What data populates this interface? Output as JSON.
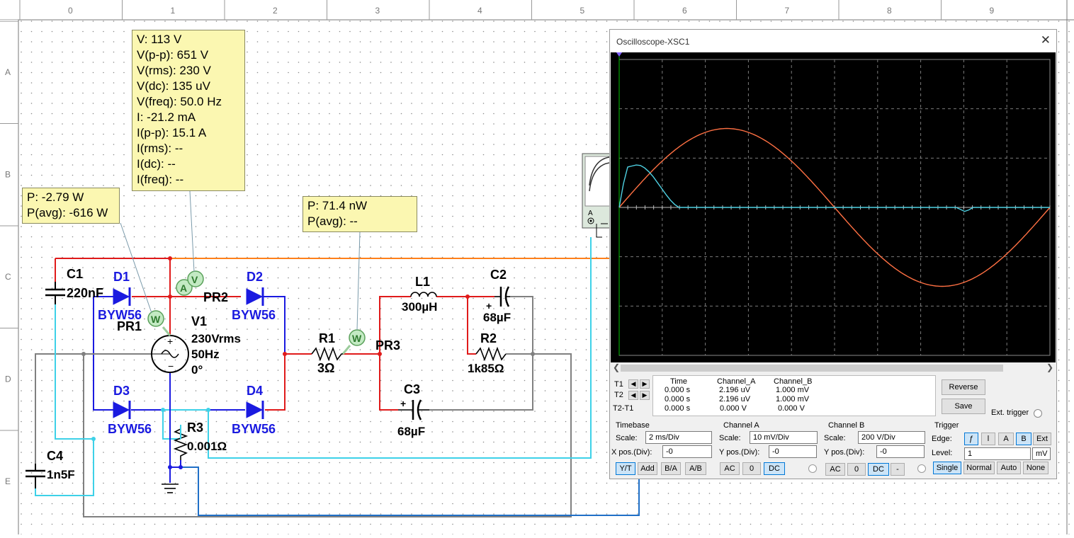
{
  "ruler": {
    "columns": [
      "0",
      "1",
      "2",
      "3",
      "4",
      "5",
      "6",
      "7",
      "8",
      "9"
    ],
    "rows": [
      "A",
      "B",
      "C",
      "D",
      "E"
    ]
  },
  "probes": {
    "v_probe": [
      "V: 113 V",
      "V(p-p): 651 V",
      "V(rms): 230 V",
      "V(dc): 135 uV",
      "V(freq): 50.0 Hz",
      "I: -21.2 mA",
      "I(p-p): 15.1 A",
      "I(rms): --",
      "I(dc): --",
      "I(freq): --"
    ],
    "pr1": [
      "P: -2.79 W",
      "P(avg): -616 W"
    ],
    "pr3": [
      "P: 71.4 nW",
      "P(avg): --"
    ]
  },
  "components": {
    "c1_name": "C1",
    "c1_value": "220nF",
    "d1_name": "D1",
    "d1_value": "BYW56",
    "d2_name": "D2",
    "d2_value": "BYW56",
    "d3_name": "D3",
    "d3_value": "BYW56",
    "d4_name": "D4",
    "d4_value": "BYW56",
    "v1_name": "V1",
    "v1_rms": "230Vrms",
    "v1_freq": "50Hz",
    "v1_phase": "0°",
    "pr1": "PR1",
    "pr2": "PR2",
    "pr3": "PR3",
    "r1_name": "R1",
    "r1_value": "3Ω",
    "r2_name": "R2",
    "r2_value": "1k85Ω",
    "r3_name": "R3",
    "r3_value": "0.001Ω",
    "l1_name": "L1",
    "l1_value": "300µH",
    "c2_name": "C2",
    "c2_value": "68µF",
    "c3_name": "C3",
    "c3_value": "68µF",
    "c4_name": "C4",
    "c4_value": "1n5F",
    "xsc_terminal": "A",
    "probe_w": "W",
    "probe_a": "A",
    "probe_v": "V"
  },
  "colors": {
    "wire_red": "#e01a1a",
    "wire_blue": "#1a1ae0",
    "wire_cyan": "#3dd1e8",
    "wire_orange": "#ff7f1a",
    "wire_gray": "#808080",
    "trace_a": "#4fd1e3",
    "trace_b": "#ff7043",
    "probe_bg": "#fbf7b1"
  },
  "oscilloscope": {
    "title": "Oscilloscope-XSC1",
    "close": "✕",
    "cursor_labels": {
      "t1": "T1",
      "t2": "T2",
      "t2t1": "T2-T1"
    },
    "table": {
      "headers": [
        "Time",
        "Channel_A",
        "Channel_B"
      ],
      "t1": [
        "0.000 s",
        "2.196 uV",
        "1.000 mV"
      ],
      "t2": [
        "0.000 s",
        "2.196 uV",
        "1.000 mV"
      ],
      "t2t1": [
        "0.000 s",
        "0.000 V",
        "0.000 V"
      ]
    },
    "reverse": "Reverse",
    "save": "Save",
    "ext_trigger": "Ext. trigger",
    "timebase": {
      "label": "Timebase",
      "scale_label": "Scale:",
      "scale": "2 ms/Div",
      "xpos_label": "X pos.(Div):",
      "xpos": "-0",
      "buttons": [
        "Y/T",
        "Add",
        "B/A",
        "A/B"
      ]
    },
    "channel_a": {
      "label": "Channel A",
      "scale_label": "Scale:",
      "scale": "10 mV/Div",
      "ypos_label": "Y pos.(Div):",
      "ypos": "-0",
      "buttons": [
        "AC",
        "0",
        "DC"
      ]
    },
    "channel_b": {
      "label": "Channel B",
      "scale_label": "Scale:",
      "scale": "200  V/Div",
      "ypos_label": "Y pos.(Div):",
      "ypos": "-0",
      "buttons": [
        "AC",
        "0",
        "DC",
        "-"
      ]
    },
    "trigger": {
      "label": "Trigger",
      "edge_label": "Edge:",
      "level_label": "Level:",
      "level": "1",
      "level_unit": "mV",
      "edge_buttons": [
        "ƒ",
        "Ɩ",
        "A",
        "B",
        "Ext"
      ],
      "mode_buttons": [
        "Single",
        "Normal",
        "Auto",
        "None"
      ]
    },
    "trace_a_samples": [
      0,
      0.48,
      0.82,
      0.84,
      0.86,
      0.85,
      0.8,
      0.72,
      0.62,
      0.5,
      0.38,
      0.26,
      0.15,
      0.06,
      0,
      0,
      0,
      0,
      0,
      0,
      0,
      0,
      0,
      0,
      0,
      0,
      0,
      0,
      0,
      0,
      0,
      0,
      0,
      0,
      0,
      0,
      0,
      0,
      0,
      0,
      0,
      0,
      0,
      0,
      0,
      0,
      0,
      0,
      0,
      0,
      0,
      0,
      0,
      0,
      0,
      0,
      0,
      0,
      0,
      0,
      0,
      0,
      0,
      0,
      0,
      0,
      0,
      0,
      0,
      0,
      0,
      0,
      0,
      0,
      0,
      0,
      0,
      0,
      0,
      0,
      -0.04,
      -0.08,
      -0.05,
      0,
      0,
      0,
      0,
      0,
      0,
      0,
      0,
      0,
      0,
      0,
      0,
      0,
      0,
      0,
      0,
      0,
      0,
      0
    ],
    "trace_b_amplitude_divisions": 1.6,
    "cycle_fraction_shown": 1.0
  }
}
